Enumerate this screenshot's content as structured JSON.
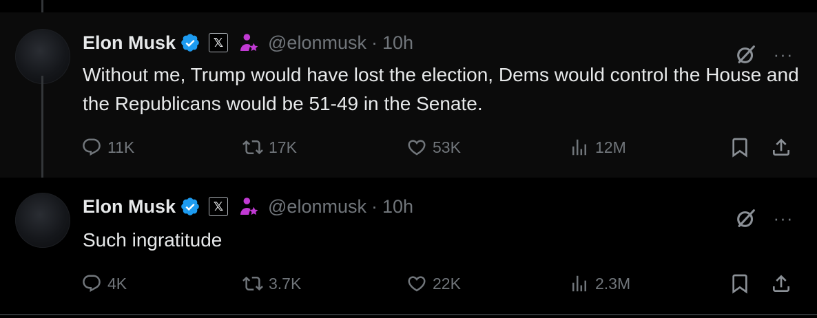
{
  "tweets": [
    {
      "name": "Elon Musk",
      "x_badge": "𝕏",
      "handle": "@elonmusk",
      "separator": "·",
      "time": "10h",
      "text": "Without me, Trump would have lost the election, Dems would control the House and the Republicans would be 51-49 in the Senate.",
      "replies": "11K",
      "retweets": "17K",
      "likes": "53K",
      "views": "12M"
    },
    {
      "name": "Elon Musk",
      "x_badge": "𝕏",
      "handle": "@elonmusk",
      "separator": "·",
      "time": "10h",
      "text": "Such ingratitude",
      "replies": "4K",
      "retweets": "3.7K",
      "likes": "22K",
      "views": "2.3M"
    }
  ],
  "more_label": "···",
  "colors": {
    "background": "#000000",
    "highlight_background": "#0b0b0b",
    "text_primary": "#e7e9ea",
    "text_secondary": "#71767b",
    "verified_blue": "#1d9bf0",
    "affiliate_magenta": "#c13ad3"
  },
  "icons": [
    "verified-badge-icon",
    "x-affiliate-badge-icon",
    "affiliate-person-icon",
    "grok-icon",
    "more-icon",
    "reply-icon",
    "retweet-icon",
    "like-icon",
    "views-icon",
    "bookmark-icon",
    "share-icon"
  ]
}
